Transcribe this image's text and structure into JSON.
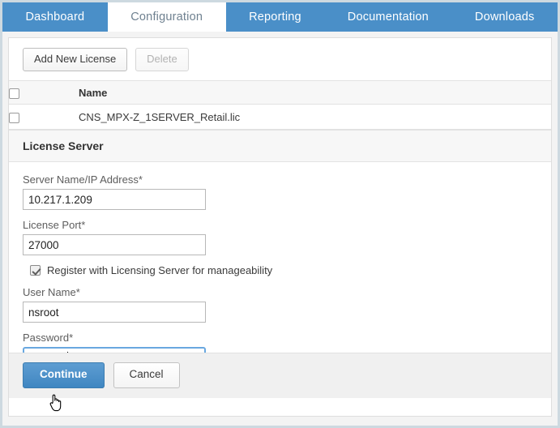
{
  "tabs": [
    {
      "label": "Dashboard",
      "active": false
    },
    {
      "label": "Configuration",
      "active": true
    },
    {
      "label": "Reporting",
      "active": false
    },
    {
      "label": "Documentation",
      "active": false
    },
    {
      "label": "Downloads",
      "active": false
    }
  ],
  "toolbar": {
    "add_license_label": "Add New License",
    "delete_label": "Delete"
  },
  "license_table": {
    "columns": [
      "",
      "Name"
    ],
    "header_name": "Name",
    "rows": [
      {
        "selected": false,
        "name": "CNS_MPX-Z_1SERVER_Retail.lic"
      }
    ],
    "select_all_checked": false
  },
  "license_server": {
    "section_title": "License Server",
    "server_name_label": "Server Name/IP Address*",
    "server_name_value": "10.217.1.209",
    "license_port_label": "License Port*",
    "license_port_value": "27000",
    "register_checkbox_label": "Register with Licensing Server for manageability",
    "register_checked": true,
    "user_name_label": "User Name*",
    "user_name_value": "nsroot",
    "password_label": "Password*",
    "password_value": "••••••",
    "password_focused": true
  },
  "footer": {
    "continue_label": "Continue",
    "cancel_label": "Cancel"
  },
  "colors": {
    "accent_blue": "#4a8fc8",
    "panel_border": "#dedede",
    "page_border": "#cdd9e0",
    "header_gray": "#f7f7f7",
    "footer_gray": "#f0f0f0",
    "focus_blue": "#69a8e0"
  },
  "cursor": {
    "type": "pointer-hand"
  }
}
